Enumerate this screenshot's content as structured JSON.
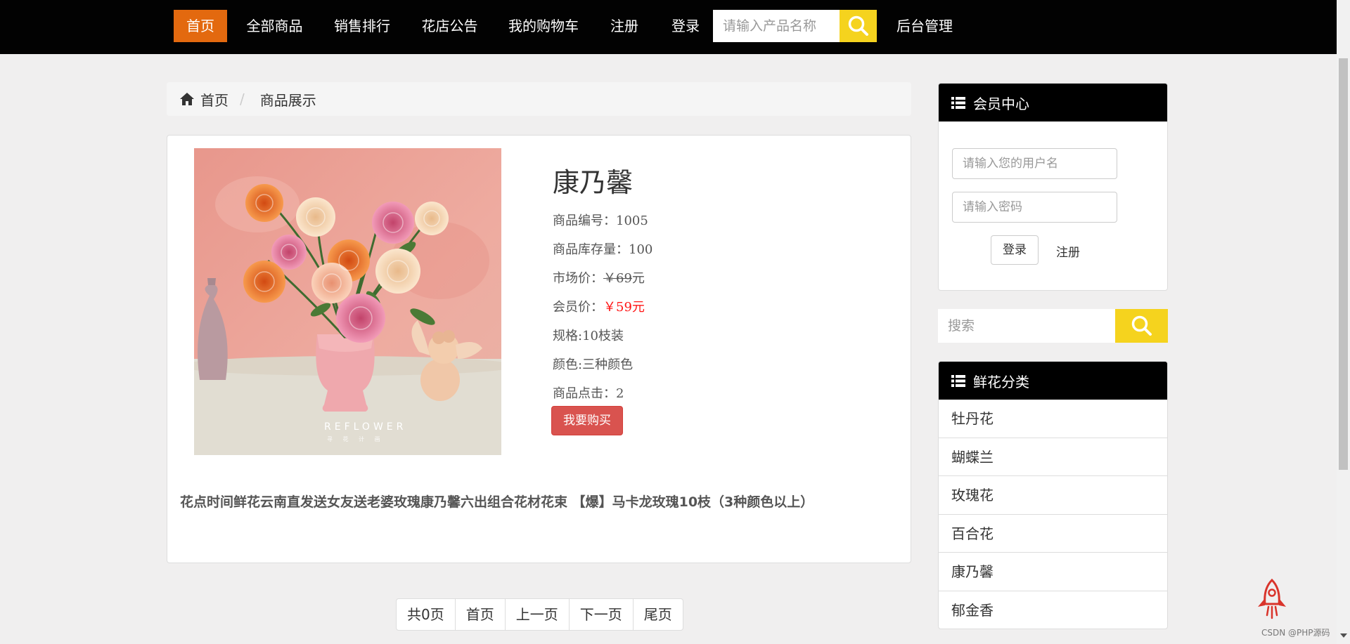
{
  "nav": {
    "items": [
      {
        "label": "首页",
        "active": true
      },
      {
        "label": "全部商品"
      },
      {
        "label": "销售排行"
      },
      {
        "label": "花店公告"
      },
      {
        "label": "我的购物车"
      },
      {
        "label": "注册"
      },
      {
        "label": "登录"
      }
    ],
    "search_placeholder": "请输入产品名称",
    "admin_label": "后台管理",
    "search_icon": "search-icon",
    "active_color": "#e3690f",
    "search_button_color": "#f5d31e"
  },
  "breadcrumb": {
    "home_icon": "home-icon",
    "home": "首页",
    "separator": "/",
    "current": "商品展示"
  },
  "product": {
    "name": "康乃馨",
    "id_label": "商品编号：",
    "id": "1005",
    "stock_label": "商品库存量：",
    "stock": "100",
    "market_price_label": "市场价：",
    "market_price": "￥69",
    "market_price_unit": "元",
    "member_price_label": "会员价：",
    "member_price": "￥59元",
    "spec": "规格:10枝装",
    "color": "颜色:三种颜色",
    "clicks_label": "商品点击：",
    "clicks": "2",
    "buy_label": "我要购买",
    "image_text_1": "REFLOWER",
    "image_text_2": "寻 花 计 画",
    "description": "花点时间鲜花云南直发送女友送老婆玫瑰康乃馨六出组合花材花束 【爆】马卡龙玫瑰10枝（3种颜色以上）",
    "price_color": "#ff1414",
    "buy_color": "#d9534f"
  },
  "pagination": {
    "total": "共0页",
    "first": "首页",
    "prev": "上一页",
    "next": "下一页",
    "last": "尾页"
  },
  "sidebar": {
    "member": {
      "icon": "list-icon",
      "title": "会员中心",
      "username_placeholder": "请输入您的用户名",
      "password_placeholder": "请输入密码",
      "login_label": "登录",
      "register_label": "注册"
    },
    "search": {
      "placeholder": "搜索",
      "icon": "search-icon"
    },
    "categories": {
      "icon": "list-icon",
      "title": "鲜花分类",
      "items": [
        "牡丹花",
        "蝴蝶兰",
        "玫瑰花",
        "百合花",
        "康乃馨",
        "郁金香"
      ]
    }
  },
  "watermark": "CSDN @PHP源码"
}
